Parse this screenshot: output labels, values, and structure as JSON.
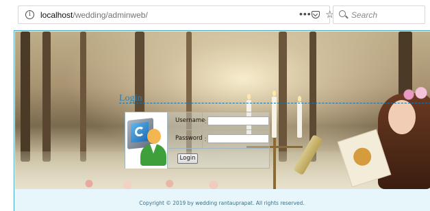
{
  "browser": {
    "url_host": "localhost",
    "url_path": "/wedding/adminweb/",
    "page_actions_label": "•••",
    "search_placeholder": "Search"
  },
  "login": {
    "title": "Login",
    "username_label": "Username",
    "password_label": "Password",
    "colon": ":",
    "username_value": "",
    "password_value": "",
    "button_label": "Login"
  },
  "footer": {
    "copyright": "Copyright © 2019 by wedding rantauprapat. All rights reserved."
  },
  "colors": {
    "accent": "#2f7fb0",
    "frame_border": "#4aa7c7",
    "footer_bg": "#e7f6fb"
  }
}
